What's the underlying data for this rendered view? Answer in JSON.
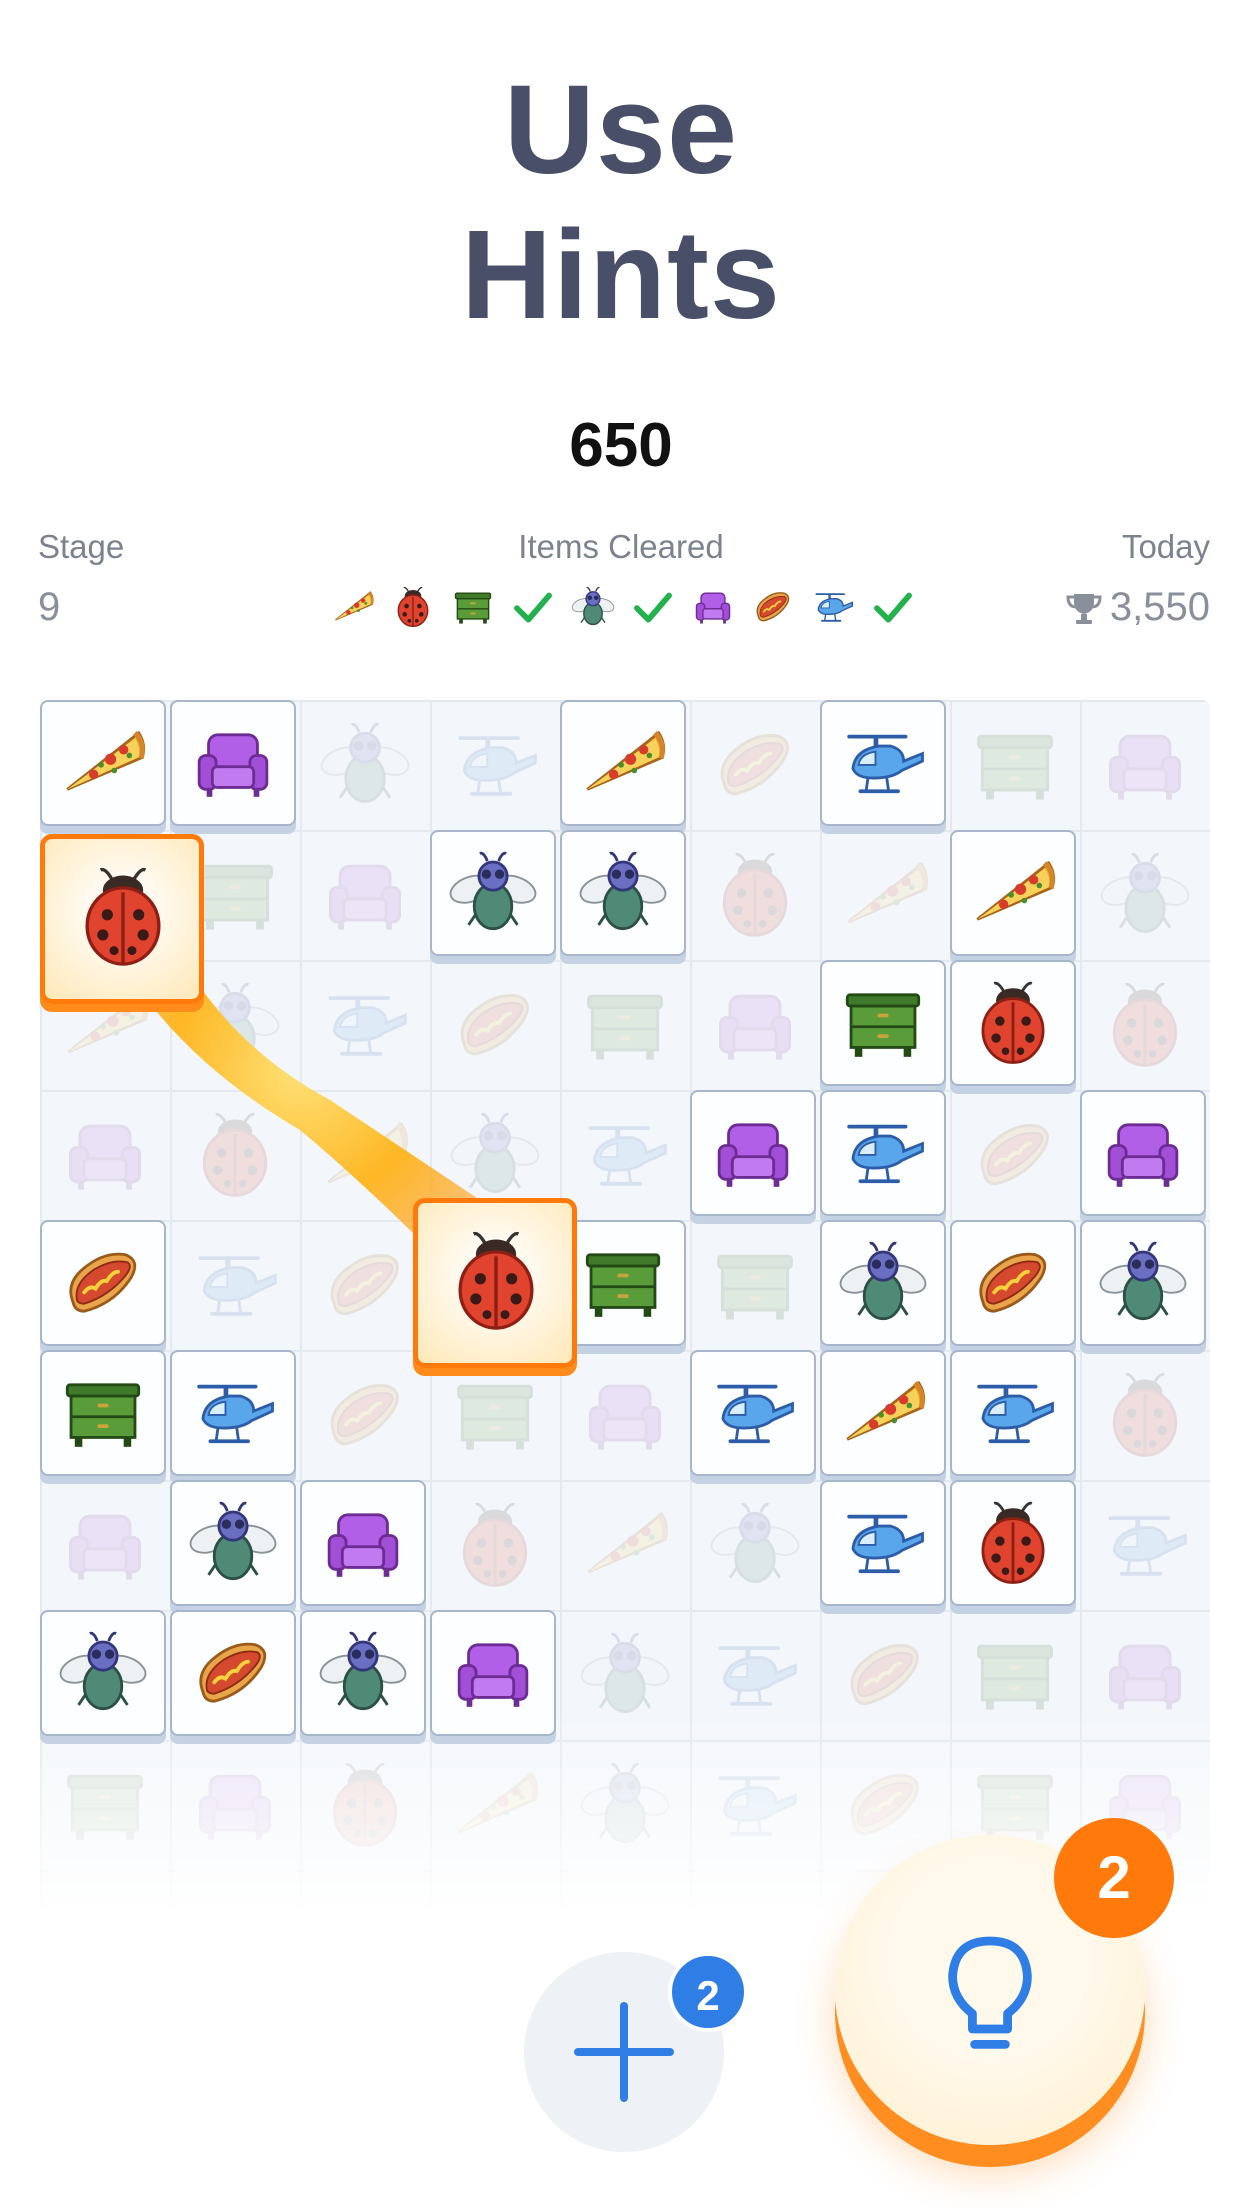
{
  "promo": {
    "line1": "Use",
    "line2": "Hints"
  },
  "hud": {
    "score": "650",
    "stage_label": "Stage",
    "stage_value": "9",
    "items_label": "Items Cleared",
    "today_label": "Today",
    "today_value": "3,550"
  },
  "items_cleared": [
    {
      "icon": "pizza-icon",
      "cleared": false
    },
    {
      "icon": "ladybug-icon",
      "cleared": false
    },
    {
      "icon": "dresser-icon",
      "cleared": true
    },
    {
      "icon": "fly-icon",
      "cleared": true
    },
    {
      "icon": "armchair-icon",
      "cleared": false
    },
    {
      "icon": "hotdog-icon",
      "cleared": false
    },
    {
      "icon": "helicopter-icon",
      "cleared": true
    }
  ],
  "board": {
    "tiles": [
      {
        "col": 0,
        "row": 0,
        "icon": "pizza"
      },
      {
        "col": 1,
        "row": 0,
        "icon": "armchair"
      },
      {
        "col": 4,
        "row": 0,
        "icon": "pizza"
      },
      {
        "col": 6,
        "row": 0,
        "icon": "helicopter"
      },
      {
        "col": 3,
        "row": 1,
        "icon": "fly"
      },
      {
        "col": 4,
        "row": 1,
        "icon": "fly"
      },
      {
        "col": 7,
        "row": 1,
        "icon": "pizza"
      },
      {
        "col": 6,
        "row": 2,
        "icon": "dresser"
      },
      {
        "col": 7,
        "row": 2,
        "icon": "ladybug"
      },
      {
        "col": 5,
        "row": 3,
        "icon": "armchair"
      },
      {
        "col": 6,
        "row": 3,
        "icon": "helicopter"
      },
      {
        "col": 8,
        "row": 3,
        "icon": "armchair"
      },
      {
        "col": 0,
        "row": 4,
        "icon": "hotdog"
      },
      {
        "col": 4,
        "row": 4,
        "icon": "dresser"
      },
      {
        "col": 6,
        "row": 4,
        "icon": "fly"
      },
      {
        "col": 7,
        "row": 4,
        "icon": "hotdog"
      },
      {
        "col": 8,
        "row": 4,
        "icon": "fly"
      },
      {
        "col": 0,
        "row": 5,
        "icon": "dresser"
      },
      {
        "col": 1,
        "row": 5,
        "icon": "helicopter"
      },
      {
        "col": 5,
        "row": 5,
        "icon": "helicopter"
      },
      {
        "col": 6,
        "row": 5,
        "icon": "pizza"
      },
      {
        "col": 7,
        "row": 5,
        "icon": "helicopter"
      },
      {
        "col": 1,
        "row": 6,
        "icon": "fly"
      },
      {
        "col": 2,
        "row": 6,
        "icon": "armchair"
      },
      {
        "col": 6,
        "row": 6,
        "icon": "helicopter"
      },
      {
        "col": 7,
        "row": 6,
        "icon": "ladybug"
      },
      {
        "col": 0,
        "row": 7,
        "icon": "fly"
      },
      {
        "col": 1,
        "row": 7,
        "icon": "hotdog"
      },
      {
        "col": 2,
        "row": 7,
        "icon": "fly"
      },
      {
        "col": 3,
        "row": 7,
        "icon": "armchair"
      }
    ],
    "hint_pair": {
      "icon": "ladybug",
      "from": "tile-a",
      "to": "tile-b"
    }
  },
  "buttons": {
    "add_badge": "2",
    "hint_badge": "2"
  },
  "colors": {
    "accent": "#ff7a0a",
    "check": "#22b14c",
    "text": "#4a4f69",
    "badge_blue": "#2f7ee6"
  }
}
